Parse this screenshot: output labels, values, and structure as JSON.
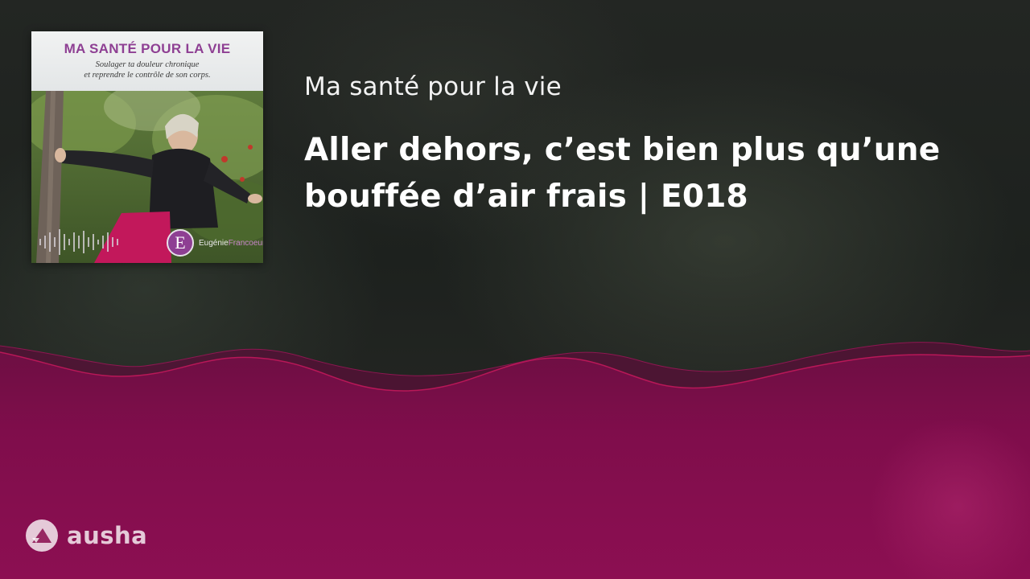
{
  "podcast": {
    "show_title": "Ma santé pour la vie",
    "episode_title": "Aller dehors, c’est bien plus qu’une bouffée d’air frais | E018"
  },
  "cover": {
    "title": "MA SANTÉ POUR LA VIE",
    "subtitle_line1": "Soulager ta douleur chronique",
    "subtitle_line2": "et reprendre le contrôle de son corps.",
    "badge_letter": "E",
    "author_first": "Eugénie",
    "author_last": "Francoeur"
  },
  "brand": {
    "name": "ausha",
    "logo_icon": "ausha-logo-icon"
  },
  "colors": {
    "wave_primary": "#8a0d4e",
    "wave_highlight": "#c2185b",
    "title_purple": "#8e3f93"
  }
}
